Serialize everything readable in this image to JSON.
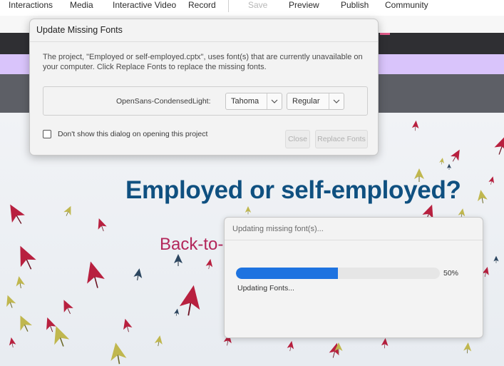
{
  "menu": {
    "items": [
      "Interactions",
      "Media",
      "Interactive Video",
      "Record"
    ],
    "save": "Save",
    "right_items": [
      "Preview",
      "Publish",
      "Community"
    ]
  },
  "slide": {
    "title": "Employed or self-employed?",
    "subtitle": "Back-to-l"
  },
  "dialog": {
    "title": "Update Missing Fonts",
    "message": "The project, \"Employed or self-employed.cptx\", uses font(s) that are currently unavailable on your computer. Click Replace Fonts to replace the missing fonts.",
    "missing_font": "OpenSans-CondensedLight:",
    "replacement_font": "Tahoma",
    "replacement_style": "Regular",
    "checkbox_label": "Don't show this dialog on opening this project",
    "checkbox_checked": false,
    "close_label": "Close",
    "replace_label": "Replace Fonts"
  },
  "progress": {
    "title": "Updating missing font(s)...",
    "percent_label": "50%",
    "percent_value": 0.5,
    "status": "Updating Fonts...",
    "bar_color": "#1e73e0"
  },
  "colors": {
    "title_blue": "#0f5080",
    "subtitle_red": "#b3265a",
    "umbrella_red": "#b8203f",
    "umbrella_olive": "#b9b24a",
    "umbrella_navy": "#2c4660"
  }
}
